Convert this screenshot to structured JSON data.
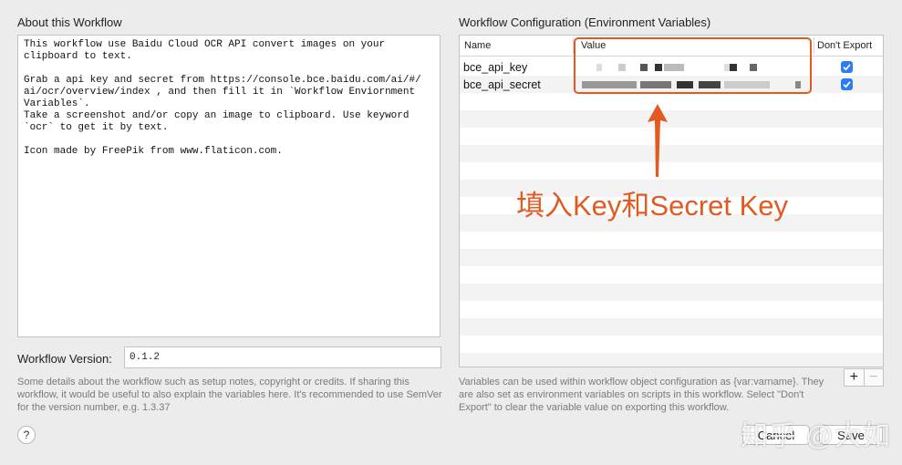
{
  "left": {
    "section_title": "About this Workflow",
    "about_text": "This workflow use Baidu Cloud OCR API convert images on your\nclipboard to text.\n\nGrab a api key and secret from https://console.bce.baidu.com/ai/#/\nai/ocr/overview/index , and then fill it in `Workflow Enviornment\nVariables`.\nTake a screenshot and/or copy an image to clipboard. Use keyword\n`ocr` to get it by text.\n\nIcon made by FreePik from www.flaticon.com.",
    "version_label": "Workflow Version:",
    "version_value": "0.1.2",
    "help_text": "Some details about the workflow such as setup notes, copyright or credits. If sharing this workflow, it would be useful to also explain the variables here. It's recommended to use SemVer for the version number, e.g. 1.3.37",
    "help_button": "?"
  },
  "right": {
    "section_title": "Workflow Configuration (Environment Variables)",
    "columns": [
      "Name",
      "Value",
      "Don't Export"
    ],
    "rows": [
      {
        "name": "bce_api_key",
        "dont_export": true
      },
      {
        "name": "bce_api_secret",
        "dont_export": true
      }
    ],
    "annotation": "填入Key和Secret Key",
    "plus_label": "+",
    "minus_label": "−",
    "help_text": "Variables can be used within workflow object configuration as {var:varname}. They are also set as environment variables on scripts in this workflow. Select \"Don't Export\" to clear the variable value on exporting this workflow."
  },
  "buttons": {
    "cancel": "Cancel",
    "save": "Save"
  },
  "watermark": "知乎 @大如",
  "colors": {
    "annotation": "#e35a20",
    "checkbox": "#2d7cf6"
  }
}
